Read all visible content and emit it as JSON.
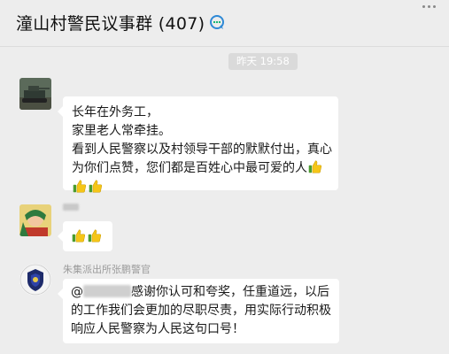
{
  "chat": {
    "title": "潼山村警民议事群 (407)",
    "title_icon": "chat-bubble-icon"
  },
  "timestamp": "昨天 19:58",
  "messages": [
    {
      "lines": [
        "长年在外务工，",
        "家里老人常牵挂。",
        "看到人民警察以及村领导干部的默默付出，真心",
        "为你们点赞，您们都是百姓心中最可爱的人"
      ],
      "emoji": "thumbs-up-icon"
    },
    {
      "emoji": "thumbs-up-icon"
    },
    {
      "nickname": "朱集派出所张鹏警官",
      "mention_prefix": "@",
      "line1_suffix": "感谢你认可和夸奖，任重道远，以后",
      "line2": "的工作我们会更加的尽职尽责，用实际行动积极",
      "line3": "响应人民警察为人民这句口号！"
    }
  ],
  "colors": {
    "background": "#ededed",
    "bubble": "#ffffff",
    "accent_icon": "#00b26a",
    "timestamp_bg": "#dadada"
  }
}
